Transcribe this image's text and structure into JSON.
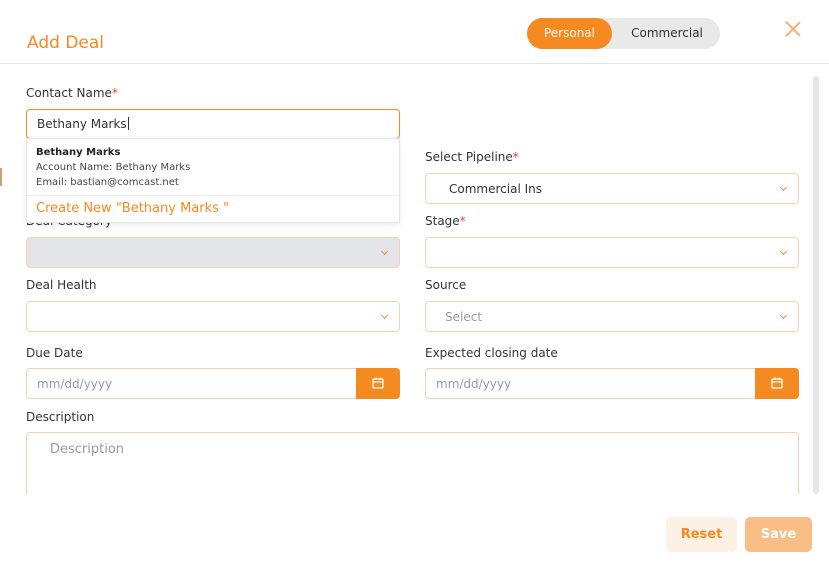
{
  "modal": {
    "title": "Add Deal",
    "toggle": {
      "personal": "Personal",
      "commercial": "Commercial",
      "selected": "Personal"
    }
  },
  "form": {
    "contact_name": {
      "label": "Contact Name",
      "required": "*",
      "value": "Bethany Marks"
    },
    "suggestion": {
      "name": "Bethany Marks",
      "account": "Account Name: Bethany Marks",
      "email": "Email: bastian@comcast.net",
      "create": "Create New \"Bethany Marks \""
    },
    "pipeline": {
      "label": "Select Pipeline",
      "required": "*",
      "value": "Commercial Ins"
    },
    "deal_category": {
      "label": "Deal Category"
    },
    "stage": {
      "label": "Stage",
      "required": "*",
      "value": ""
    },
    "deal_health": {
      "label": "Deal Health",
      "value": ""
    },
    "source": {
      "label": "Source",
      "placeholder": "Select"
    },
    "due_date": {
      "label": "Due Date",
      "placeholder": "mm/dd/yyyy"
    },
    "expected_closing": {
      "label": "Expected closing date",
      "placeholder": "mm/dd/yyyy"
    },
    "description": {
      "label": "Description",
      "placeholder": "Description"
    }
  },
  "footer": {
    "reset": "Reset",
    "save": "Save"
  },
  "colors": {
    "accent": "#f58a20",
    "accent_light": "#fdf1e6",
    "save_disabled": "#f8be86",
    "required": "#e0413a"
  },
  "icons": [
    "close-icon",
    "chevron-down-icon",
    "calendar-icon"
  ]
}
